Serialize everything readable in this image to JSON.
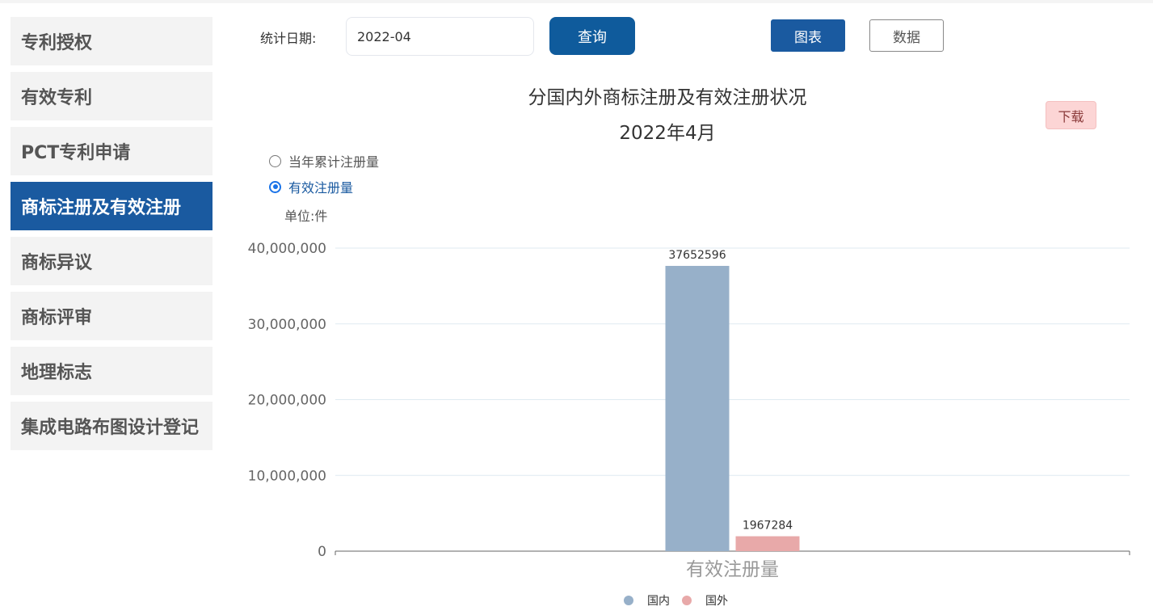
{
  "sidebar": {
    "items": [
      {
        "label": "专利授权"
      },
      {
        "label": "有效专利"
      },
      {
        "label": "PCT专利申请"
      },
      {
        "label": "商标注册及有效注册",
        "active": true
      },
      {
        "label": "商标异议"
      },
      {
        "label": "商标评审"
      },
      {
        "label": "地理标志"
      },
      {
        "label": "集成电路布图设计登记"
      }
    ]
  },
  "toolbar": {
    "date_label": "统计日期:",
    "date_value": "2022-04",
    "query_label": "查询",
    "chart_label": "图表",
    "data_label": "数据"
  },
  "chart_header": {
    "title": "分国内外商标注册及有效注册状况",
    "subtitle": "2022年4月",
    "download_label": "下载"
  },
  "options": {
    "items": [
      {
        "label": "当年累计注册量",
        "checked": false
      },
      {
        "label": "有效注册量",
        "checked": true
      }
    ],
    "unit": "单位:件"
  },
  "chart_data": {
    "type": "bar",
    "categories": [
      "有效注册量"
    ],
    "series": [
      {
        "name": "国内",
        "values": [
          37652596
        ],
        "labels": [
          "37652596"
        ],
        "color": "#97b0c9"
      },
      {
        "name": "国外",
        "values": [
          1967284
        ],
        "labels": [
          "1967284"
        ],
        "color": "#e8a9a9"
      }
    ],
    "ylim": [
      0,
      40000000
    ],
    "yticks": [
      {
        "value": 0,
        "label": "0"
      },
      {
        "value": 10000000,
        "label": "10,000,000"
      },
      {
        "value": 20000000,
        "label": "20,000,000"
      },
      {
        "value": 30000000,
        "label": "30,000,000"
      },
      {
        "value": 40000000,
        "label": "40,000,000"
      }
    ],
    "grid": true,
    "legend": "bottom-center"
  }
}
